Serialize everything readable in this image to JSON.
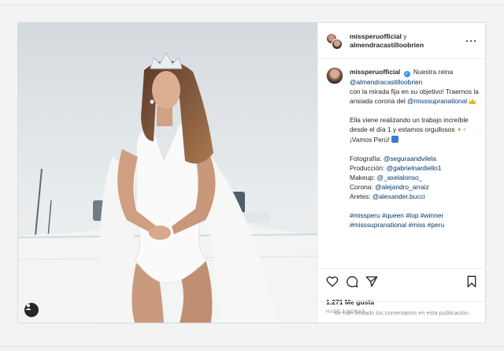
{
  "header": {
    "owner_username": "missperuofficial",
    "connector": "y",
    "collaborator_username": "almendracastilloobrien"
  },
  "caption": {
    "username": "missperuofficial",
    "line1": "Nuestra reina",
    "mention_queen": "@almendracastilloobrien",
    "line2": "con la mirada fija en su objetivo! Traernos la ansiada corona del",
    "mention_pageant": "@misssupranational",
    "para2": "Ella viene realizando un trabajo increíble desde el día 1 y estamos orgullosos",
    "para2_end": "¡Vamos Perú!",
    "credits": [
      {
        "label": "Fotografía:",
        "handle": "@seguraandvilela"
      },
      {
        "label": "Producción:",
        "handle": "@gabrielnardiello1"
      },
      {
        "label": "Makeup:",
        "handle": "@_axelalonso_"
      },
      {
        "label": "Corona:",
        "handle": "@alejandro_arraiz"
      },
      {
        "label": "Aretes:",
        "handle": "@alexander.bucci"
      }
    ],
    "hashtags_line1": "#missperu #queen #top #winner",
    "hashtags_line2": "#misssupranational #miss #peru"
  },
  "engagement": {
    "likes": "1.271 Me gusta",
    "time": "HACE 2 HORAS"
  },
  "comments_notice": "Se han limitado los comentarios en esta publicación.",
  "icons": [
    "heart-icon",
    "comment-icon",
    "share-icon",
    "bookmark-icon",
    "more-icon",
    "user-tag-icon"
  ]
}
